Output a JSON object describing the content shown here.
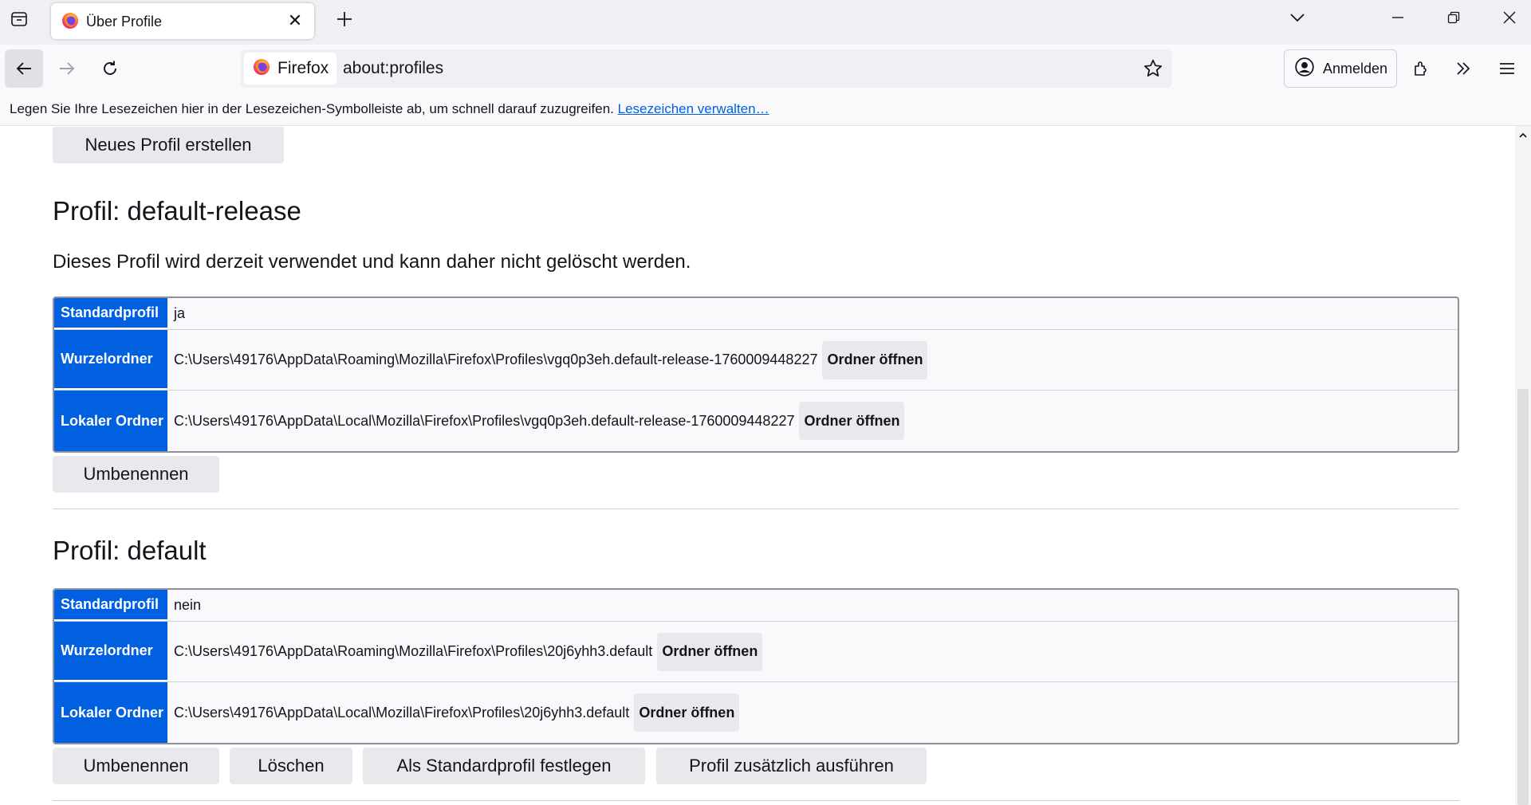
{
  "window": {
    "tab_title": "Über Profile",
    "tab_close_glyph": "✕",
    "icons": [
      "tab-overview-icon",
      "firefox-logo-icon",
      "new-tab-icon",
      "list-all-tabs-icon",
      "minimize-icon",
      "restore-icon",
      "window-close-icon"
    ]
  },
  "navbar": {
    "identity_label": "Firefox",
    "url": "about:profiles",
    "signin_label": "Anmelden",
    "icons": [
      "back-icon",
      "forward-icon",
      "reload-icon",
      "bookmark-star-icon",
      "account-icon",
      "extensions-icon",
      "overflow-icon",
      "menu-icon"
    ]
  },
  "bookmarks_bar": {
    "text": "Legen Sie Ihre Lesezeichen hier in der Lesezeichen-Symbolleiste ab, um schnell darauf zuzugreifen. ",
    "link": "Lesezeichen verwalten…"
  },
  "page": {
    "new_profile_button": "Neues Profil erstellen",
    "profiles": [
      {
        "title": "Profil: default-release",
        "in_use_note": "Dieses Profil wird derzeit verwendet und kann daher nicht gelöscht werden.",
        "rows": {
          "default_label": "Standardprofil",
          "default_value": "ja",
          "root_label": "Wurzelordner",
          "root_value": "C:\\Users\\49176\\AppData\\Roaming\\Mozilla\\Firefox\\Profiles\\vgq0p3eh.default-release-1760009448227",
          "local_label": "Lokaler Ordner",
          "local_value": "C:\\Users\\49176\\AppData\\Local\\Mozilla\\Firefox\\Profiles\\vgq0p3eh.default-release-1760009448227",
          "open_folder": "Ordner öffnen"
        },
        "buttons": {
          "rename": "Umbenennen"
        }
      },
      {
        "title": "Profil: default",
        "rows": {
          "default_label": "Standardprofil",
          "default_value": "nein",
          "root_label": "Wurzelordner",
          "root_value": "C:\\Users\\49176\\AppData\\Roaming\\Mozilla\\Firefox\\Profiles\\20j6yhh3.default",
          "local_label": "Lokaler Ordner",
          "local_value": "C:\\Users\\49176\\AppData\\Local\\Mozilla\\Firefox\\Profiles\\20j6yhh3.default",
          "open_folder": "Ordner öffnen"
        },
        "buttons": {
          "rename": "Umbenennen",
          "delete": "Löschen",
          "set_default": "Als Standardprofil festlegen",
          "launch": "Profil zusätzlich ausführen"
        }
      }
    ]
  },
  "colors": {
    "accent": "#0060df",
    "link": "#0061e0",
    "button_bg": "#e9e9ed",
    "chrome_bg": "#f0f0f4"
  }
}
